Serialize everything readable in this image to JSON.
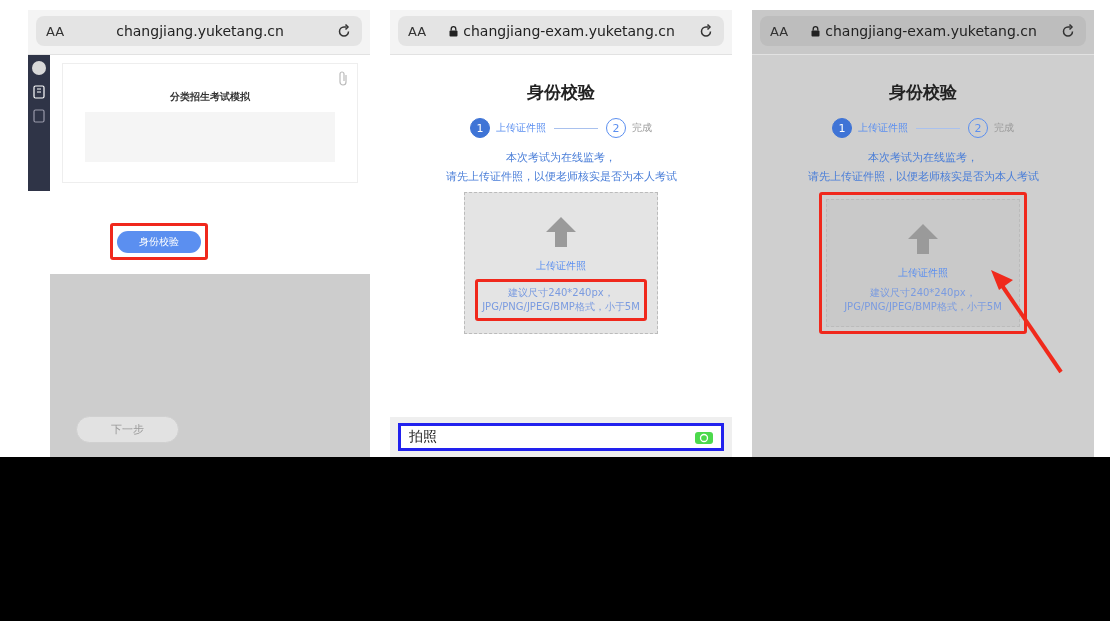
{
  "screens": [
    {
      "kind": "course",
      "dimmed": false,
      "button_highlighted": true,
      "address_bar": {
        "font_button": "AA",
        "url": "changjiang.yuketang.cn",
        "secure": false
      },
      "page_title": "分类招生考试模拟",
      "verify_button": "身份校验",
      "next_button": "下一步"
    },
    {
      "kind": "verify",
      "dimmed": false,
      "hint_highlighted": true,
      "upload_highlighted": false,
      "arrow": false,
      "address_bar": {
        "font_button": "AA",
        "url": "changjiang-exam.yuketang.cn",
        "secure": true
      },
      "title": "身份校验",
      "steps": [
        {
          "number": "1",
          "label": "上传证件照",
          "selected": true
        },
        {
          "number": "2",
          "label": "完成",
          "selected": false
        }
      ],
      "notice": [
        "本次考试为在线监考，",
        "请先上传证件照，以便老师核实是否为本人考试"
      ],
      "upload": {
        "label": "上传证件照",
        "hint": [
          "建议尺寸240*240px，",
          "JPG/PNG/JPEG/BMP格式，小于5M"
        ]
      },
      "photo_option": "拍照"
    },
    {
      "kind": "verify",
      "dimmed": true,
      "hint_highlighted": false,
      "upload_highlighted": true,
      "arrow": true,
      "address_bar": {
        "font_button": "AA",
        "url": "changjiang-exam.yuketang.cn",
        "secure": true
      },
      "title": "身份校验",
      "steps": [
        {
          "number": "1",
          "label": "上传证件照",
          "selected": true
        },
        {
          "number": "2",
          "label": "完成",
          "selected": false
        }
      ],
      "notice": [
        "本次考试为在线监考，",
        "请先上传证件照，以便老师核实是否为本人考试"
      ],
      "upload": {
        "label": "上传证件照",
        "hint": [
          "建议尺寸240*240px，",
          "JPG/PNG/JPEG/BMP格式，小于5M"
        ]
      }
    }
  ]
}
